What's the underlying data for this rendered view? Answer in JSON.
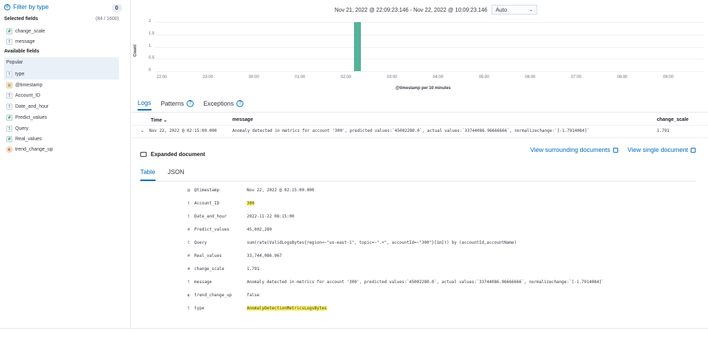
{
  "sidebar": {
    "filter_label": "Filter by type",
    "filter_count": "0",
    "selected_heading": "Selected fields",
    "selected_count": "(84 / 1600)",
    "selected_fields": [
      {
        "type": "#",
        "name": "change_scale"
      },
      {
        "type": "t",
        "name": "message"
      }
    ],
    "available_heading": "Available fields",
    "popular_heading": "Popular",
    "popular_fields": [
      {
        "type": "t",
        "name": "type"
      }
    ],
    "available_fields": [
      {
        "type": "date",
        "name": "@timestamp"
      },
      {
        "type": "t",
        "name": "Account_ID"
      },
      {
        "type": "t",
        "name": "Date_and_hour"
      },
      {
        "type": "#",
        "name": "Predict_values"
      },
      {
        "type": "t",
        "name": "Query"
      },
      {
        "type": "#",
        "name": "Real_values"
      },
      {
        "type": "bool",
        "name": "trend_change_up"
      }
    ]
  },
  "header": {
    "time_range": "Nov 21, 2022 @ 22:09:23.146 - Nov 22, 2022 @ 10:09:23.146",
    "interval": "Auto"
  },
  "histogram": {
    "y_title": "Count",
    "y_ticks": [
      "2",
      "1.5",
      "1",
      "0.5",
      "0"
    ],
    "x_ticks": [
      "22:00",
      "23:00",
      "00:00",
      "01:00",
      "02:00",
      "03:00",
      "04:00",
      "05:00",
      "06:00",
      "07:00",
      "08:00",
      "09:00"
    ],
    "x_title": "@timestamp per 10 minutes",
    "bar_color": "#54b399",
    "bars": [
      {
        "time": "02:10",
        "count": 2
      }
    ]
  },
  "tabs": [
    {
      "label": "Logs",
      "help": false
    },
    {
      "label": "Patterns",
      "help": true
    },
    {
      "label": "Exceptions",
      "help": true
    }
  ],
  "table": {
    "col_time": "Time",
    "col_message": "message",
    "col_change": "change_scale",
    "row": {
      "time": "Nov 22, 2022 @ 02:15:00.000",
      "message": "Anomaly detected in metrics for account '300', predicted values:`45002280.0`, actual values:`33744086.96666666`, normalizechange:`[-1.7914084]`",
      "change_scale": "1.791"
    }
  },
  "expanded": {
    "title": "Expanded document",
    "view_surrounding": "View surrounding documents",
    "view_single": "View single document",
    "subtabs": [
      "Table",
      "JSON"
    ],
    "fields": [
      {
        "icon": "date",
        "name": "@timestamp",
        "value": "Nov 22, 2022 @ 02:15:00.000",
        "highlight": false
      },
      {
        "icon": "t",
        "name": "Account_ID",
        "value": "300",
        "highlight": true
      },
      {
        "icon": "t",
        "name": "Date_and_hour",
        "value": "2022-11-22 08:15:00",
        "highlight": false
      },
      {
        "icon": "#",
        "name": "Predict_values",
        "value": "45,002,280",
        "highlight": false
      },
      {
        "icon": "t",
        "name": "Query",
        "value": "sum(rate(ValidLogsBytes{region=~\"us-east-1\", topic=~\".+\", accountId=~\"300\"}[1m])) by (accountId,accountName)",
        "highlight": false
      },
      {
        "icon": "#",
        "name": "Real_values",
        "value": "33,744,086.967",
        "highlight": false
      },
      {
        "icon": "#",
        "name": "change_scale",
        "value": "1.791",
        "highlight": false
      },
      {
        "icon": "t",
        "name": "message",
        "value": "Anomaly detected in metrics for account '300', predicted values:`45002280.0`, actual values:`33744086.96666666`, normalizechange:`[-1.7914084]`",
        "highlight": false
      },
      {
        "icon": "bool",
        "name": "trend_change_up",
        "value": "false",
        "highlight": false
      },
      {
        "icon": "t",
        "name": "type",
        "value": "AnomalyDetectionMetricsLogsBytes",
        "highlight": true
      }
    ]
  }
}
